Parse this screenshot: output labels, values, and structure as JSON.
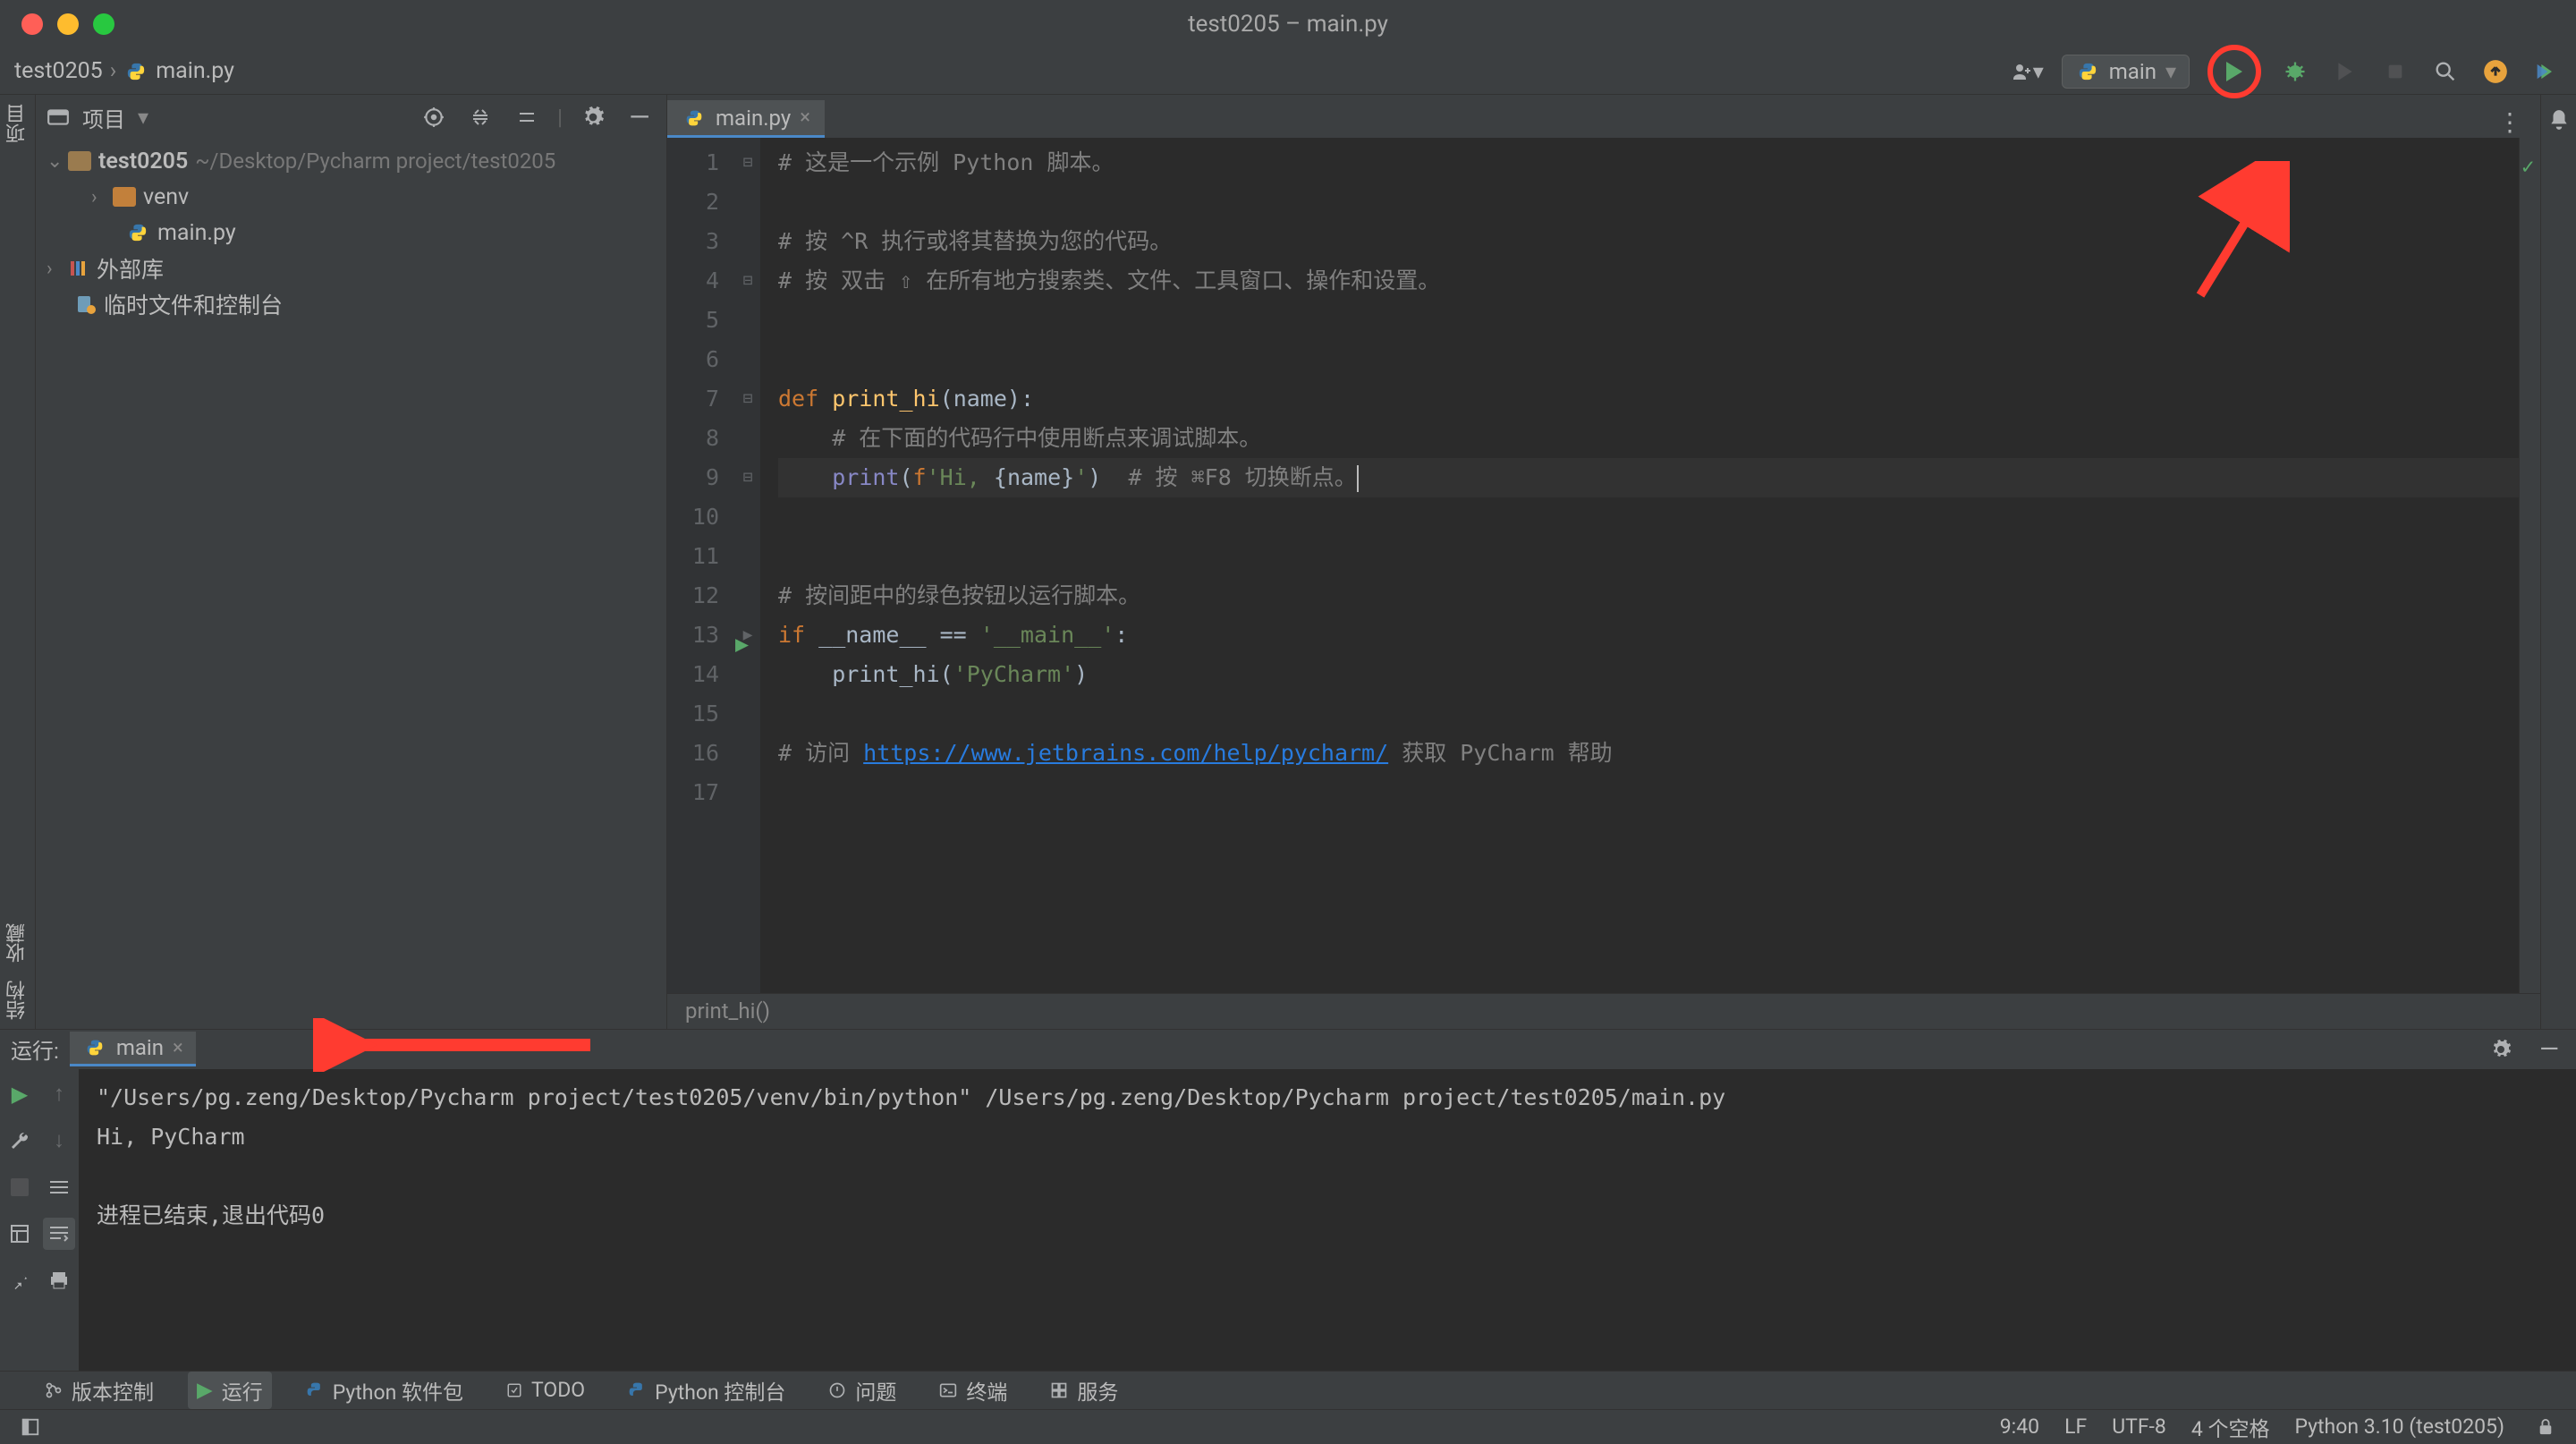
{
  "window": {
    "title": "test0205 – main.py"
  },
  "breadcrumbs": {
    "project": "test0205",
    "file": "main.py",
    "sep": "›"
  },
  "run_config": {
    "label": "main"
  },
  "project_panel": {
    "title": "项目",
    "root": "test0205",
    "root_path": "~/Desktop/Pycharm project/test0205",
    "items": [
      "venv",
      "main.py"
    ],
    "ext_lib": "外部库",
    "scratches": "临时文件和控制台"
  },
  "editor": {
    "tab": "main.py",
    "lines": [
      "# 这是一个示例 Python 脚本。",
      "",
      "# 按 ^R 执行或将其替换为您的代码。",
      "# 按 双击 ⇧ 在所有地方搜索类、文件、工具窗口、操作和设置。",
      "",
      "",
      "def print_hi(name):",
      "    # 在下面的代码行中使用断点来调试脚本。",
      "    print(f'Hi, {name}')  # 按 ⌘F8 切换断点。",
      "",
      "",
      "# 按间距中的绿色按钮以运行脚本。",
      "if __name__ == '__main__':",
      "    print_hi('PyCharm')",
      "",
      "# 访问 https://www.jetbrains.com/help/pycharm/ 获取 PyCharm 帮助",
      ""
    ],
    "line_numbers": [
      1,
      2,
      3,
      4,
      5,
      6,
      7,
      8,
      9,
      10,
      11,
      12,
      13,
      14,
      15,
      16,
      17
    ],
    "fn_breadcrumb": "print_hi()"
  },
  "run_panel": {
    "title": "运行:",
    "tab": "main",
    "cmd": "\"/Users/pg.zeng/Desktop/Pycharm project/test0205/venv/bin/python\" /Users/pg.zeng/Desktop/Pycharm project/test0205/main.py",
    "output1": "Hi, PyCharm",
    "output2": "进程已结束,退出代码0"
  },
  "bottom_tabs": {
    "vcs": "版本控制",
    "run": "运行",
    "packages": "Python 软件包",
    "todo": "TODO",
    "console": "Python 控制台",
    "problems": "问题",
    "terminal": "终端",
    "services": "服务"
  },
  "status": {
    "pos": "9:40",
    "le": "LF",
    "enc": "UTF-8",
    "indent": "4 个空格",
    "python": "Python 3.10 (test0205)"
  },
  "left_gutter": {
    "project": "项目"
  },
  "left_gutter2": {
    "favorites": "收藏",
    "structure": "结构"
  }
}
